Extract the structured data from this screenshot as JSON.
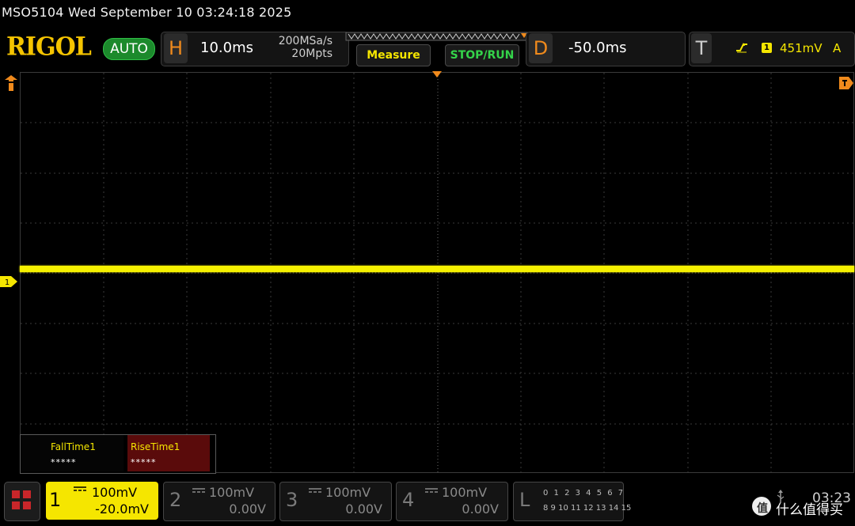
{
  "window": {
    "title": "MSO5104  Wed September 10 03:24:18 2025"
  },
  "brand": {
    "logo": "RIGOL",
    "mode": "AUTO"
  },
  "horizontal": {
    "label": "H",
    "timebase": "10.0ms",
    "sample_rate": "200MSa/s",
    "memory_depth": "20Mpts"
  },
  "buttons": {
    "measure": "Measure",
    "stop_run": "STOP/RUN"
  },
  "delay": {
    "label": "D",
    "value": "-50.0ms"
  },
  "trigger": {
    "label": "T",
    "source": "1",
    "level": "451mV",
    "mode": "A"
  },
  "measurements": [
    {
      "name": "FallTime1",
      "value": "*****"
    },
    {
      "name": "RiseTime1",
      "value": "*****"
    }
  ],
  "channels": [
    {
      "num": "1",
      "scale": "100mV",
      "offset": "-20.0mV"
    },
    {
      "num": "2",
      "scale": "100mV",
      "offset": "0.00V"
    },
    {
      "num": "3",
      "scale": "100mV",
      "offset": "0.00V"
    },
    {
      "num": "4",
      "scale": "100mV",
      "offset": "0.00V"
    }
  ],
  "logic": {
    "label": "L",
    "row1": "0 1 2 3  4 5 6 7",
    "row2": "8 9 10 11 12 13 14 15"
  },
  "ch1_marker": "1",
  "status": {
    "clock": "03:23"
  },
  "watermark": {
    "text": "什么值得买"
  },
  "colors": {
    "ch1": "#f5e600",
    "accent": "#f08a1c",
    "run": "#34d34a",
    "logo": "#f5c400"
  }
}
